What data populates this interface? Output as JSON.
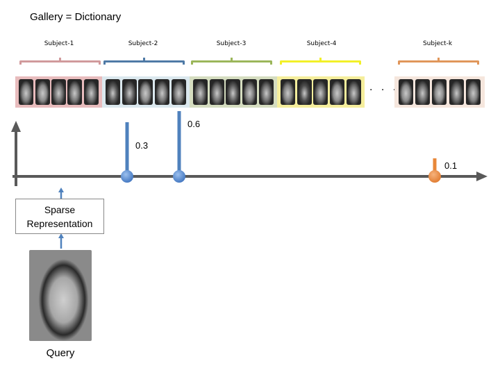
{
  "title": "Gallery = Dictionary",
  "subjects": [
    {
      "label": "Subject-1",
      "color": "#d19a9c",
      "bg": "#e8bcbd",
      "faces": [
        "#7d7d7d",
        "#8a8a8a",
        "#6e6e6e",
        "#777777",
        "#6a6a6a"
      ]
    },
    {
      "label": "Subject-2",
      "color": "#4f7aa6",
      "bg": "#dbe8ee",
      "faces": [
        "#5a5a5a",
        "#616161",
        "#8a8a8a",
        "#747474",
        "#7a7a7a"
      ]
    },
    {
      "label": "Subject-3",
      "color": "#9bb65a",
      "bg": "#d5ddc0",
      "faces": [
        "#6b6b6b",
        "#707070",
        "#5e5e5e",
        "#7a7a7a",
        "#6f6f6f"
      ]
    },
    {
      "label": "Subject-4",
      "color": "#f2f028",
      "bg": "#f5ee9c",
      "faces": [
        "#7f7f7f",
        "#4e4e4e",
        "#6a6a6a",
        "#8a8a8a",
        "#6c6c6c"
      ]
    },
    {
      "label": "Subject-k",
      "color": "#e0965a",
      "bg": "#f5e6dd",
      "faces": [
        "#8a8a8a",
        "#6c6c6c",
        "#8b8b8b",
        "#6a6a6a",
        "#7e7e7e"
      ]
    }
  ],
  "ellipsis": ". . .",
  "coefficients": [
    {
      "label": "0.3",
      "value": 0.3,
      "color": "#4f81bd"
    },
    {
      "label": "0.6",
      "value": 0.6,
      "color": "#4f81bd"
    },
    {
      "label": "0.1",
      "value": 0.1,
      "color": "#e8883a"
    }
  ],
  "sparse_box": {
    "line1": "Sparse",
    "line2": "Representation"
  },
  "query_label": "Query",
  "colors": {
    "axis": "#595959",
    "arrow": "#4f81bd"
  }
}
